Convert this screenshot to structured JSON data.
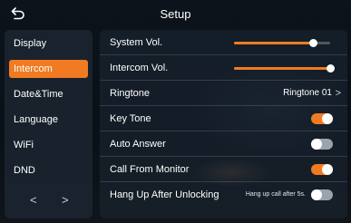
{
  "header": {
    "title": "Setup",
    "back_icon": "back-arrow-icon"
  },
  "sidebar": {
    "items": [
      {
        "label": "Display",
        "active": false
      },
      {
        "label": "Intercom",
        "active": true
      },
      {
        "label": "Date&Time",
        "active": false
      },
      {
        "label": "Language",
        "active": false
      },
      {
        "label": "WiFi",
        "active": false
      },
      {
        "label": "DND",
        "active": false
      }
    ],
    "prev_glyph": "<",
    "next_glyph": ">"
  },
  "settings": {
    "system_vol": {
      "label": "System Vol.",
      "level": 0.82
    },
    "intercom_vol": {
      "label": "Intercom Vol.",
      "level": 1.0
    },
    "ringtone": {
      "label": "Ringtone",
      "value": "Ringtone 01",
      "chevron": ">"
    },
    "key_tone": {
      "label": "Key Tone",
      "on": true
    },
    "auto_answer": {
      "label": "Auto Answer",
      "on": false
    },
    "call_from_monitor": {
      "label": "Call From Monitor",
      "on": true
    },
    "hang_up_after_unlocking": {
      "label": "Hang Up After Unlocking",
      "hint": "Hang up call after 5s.",
      "on": false
    }
  },
  "colors": {
    "accent": "#f07b22",
    "toggle_off": "#9aa3ad"
  }
}
